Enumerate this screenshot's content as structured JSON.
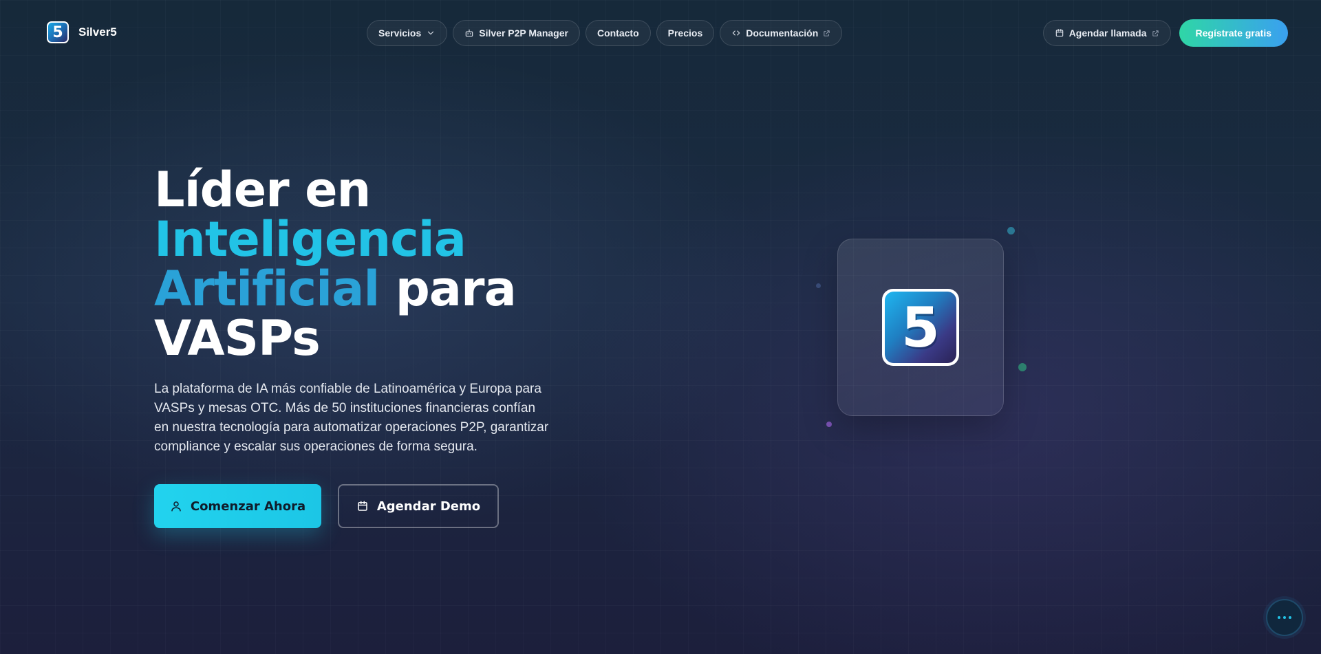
{
  "brand": {
    "name": "Silver5",
    "logo_glyph": "5"
  },
  "nav": {
    "items": [
      {
        "label": "Servicios",
        "icon": "chevron-down-icon"
      },
      {
        "label": "Silver P2P Manager",
        "icon": "bot-icon"
      },
      {
        "label": "Contacto"
      },
      {
        "label": "Precios"
      },
      {
        "label": "Documentación",
        "icon": "code-icon",
        "external": true
      }
    ],
    "call_label": "Agendar llamada",
    "register_label": "Regístrate gratis"
  },
  "hero": {
    "title_line1": "Líder en",
    "title_highlight1": "Inteligencia",
    "title_highlight2": "Artificial",
    "title_part3": "para",
    "title_line4": "VASPs",
    "subtitle": "La plataforma de IA más confiable de Latinoamérica y Europa para VASPs y mesas OTC. Más de 50 instituciones financieras confían en nuestra tecnología para automatizar operaciones P2P, garantizar compliance y escalar sus operaciones de forma segura.",
    "primary_button": "Comenzar Ahora",
    "secondary_button": "Agendar Demo"
  },
  "visual": {
    "logo_glyph": "5"
  },
  "colors": {
    "accent_cyan": "#22d3ee",
    "accent_green": "#2fd6a6",
    "accent_blue": "#3aa0f0",
    "background": "#1b2a42"
  }
}
